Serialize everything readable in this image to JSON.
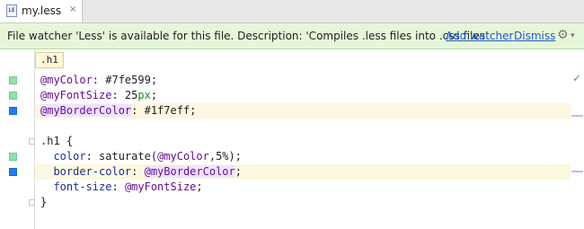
{
  "tab": {
    "label": "my.less",
    "close": "×",
    "icon": "less-file-icon"
  },
  "notification": {
    "text": "File watcher 'Less' is available for this file. Description: 'Compiles .less files into .css files'",
    "add_watcher": "Add watcher",
    "dismiss": "Dismiss",
    "gear": "⚙",
    "gear_arrow": "▾"
  },
  "breadcrumb": ".h1",
  "code": {
    "l1_var": "@myColor",
    "l1_rest": ": #7fe599;",
    "l2_var": "@myFontSize",
    "l2_sep": ": 25",
    "l2_unit": "px",
    "l2_end": ";",
    "l3_var": "@myBorderColor",
    "l3_rest": ": #1f7eff;",
    "l5": ".h1 {",
    "l6_prop": "color",
    "l6_a": ": saturate(",
    "l6_var": "@myColor",
    "l6_b": ",5%);",
    "l7_prop": "border-color",
    "l7_a": ": ",
    "l7_var": "@myBorderColor",
    "l7_b": ";",
    "l8_prop": "font-size",
    "l8_a": ": ",
    "l8_var": "@myFontSize",
    "l8_b": ";",
    "l9": "}"
  },
  "status_check": "✓",
  "colors": {
    "green_swatch": "#7fe599",
    "blue_swatch": "#1f7eff",
    "notice_bg": "#e6f7d9"
  }
}
